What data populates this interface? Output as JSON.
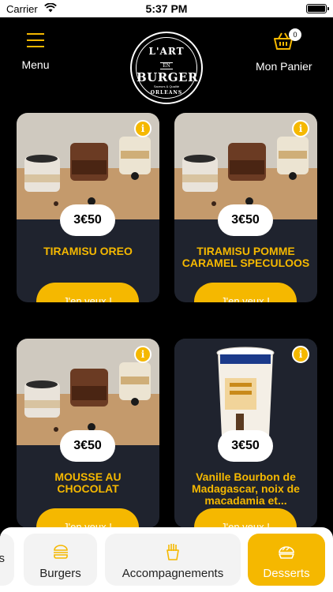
{
  "status": {
    "carrier": "Carrier",
    "time": "5:37 PM"
  },
  "header": {
    "menu_label": "Menu",
    "cart_label": "Mon Panier",
    "cart_count": "0",
    "logo": {
      "line1": "L'ART",
      "line2": "EN",
      "line3": "BURGER",
      "line4": "Saveurs & Qualité",
      "line5": "ORLEANS"
    }
  },
  "products": [
    {
      "name": "TIRAMISU OREO",
      "price": "3€50",
      "cta": "J'en veux !"
    },
    {
      "name": "TIRAMISU POMME CARAMEL SPECULOOS",
      "price": "3€50",
      "cta": "J'en veux !"
    },
    {
      "name": "MOUSSE AU CHOCOLAT",
      "price": "3€50",
      "cta": "J'en veux !"
    },
    {
      "name": "Vanille Bourbon de Madagascar, noix de macadamia et...",
      "price": "3€50",
      "cta": "J'en veux !"
    }
  ],
  "tabs": [
    {
      "label": "s",
      "active": false
    },
    {
      "label": "Burgers",
      "active": false
    },
    {
      "label": "Accompagnements",
      "active": false
    },
    {
      "label": "Desserts",
      "active": true
    }
  ],
  "colors": {
    "accent": "#f5b800",
    "card": "#1f232e",
    "background": "#000000"
  }
}
